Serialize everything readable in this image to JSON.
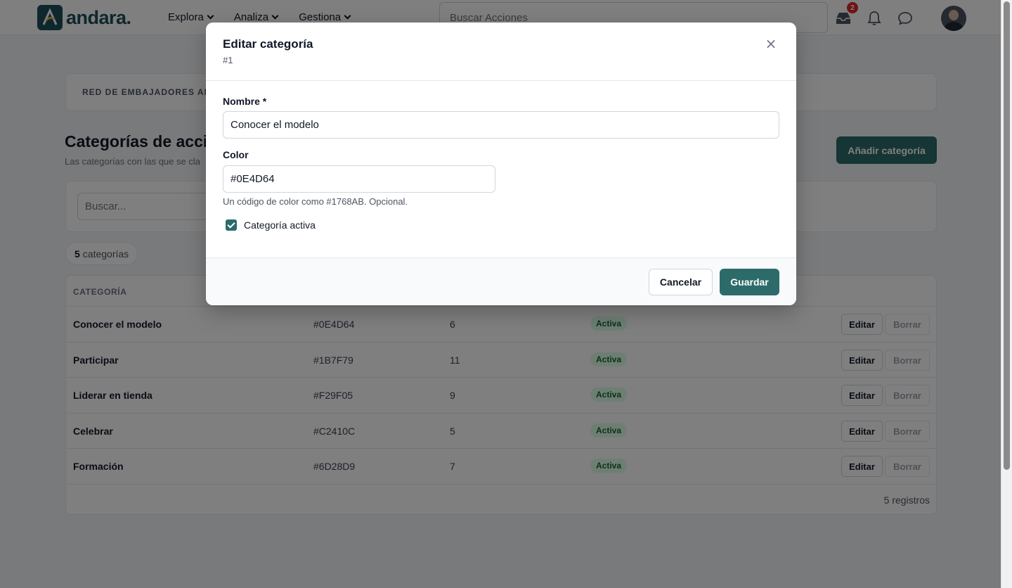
{
  "header": {
    "brand": "andara.",
    "nav": [
      {
        "label": "Explora"
      },
      {
        "label": "Analiza"
      },
      {
        "label": "Gestiona"
      }
    ],
    "search_placeholder": "Buscar Acciones",
    "inbox_badge": "2",
    "icons": [
      "inbox-icon",
      "bell-icon",
      "chat-icon"
    ]
  },
  "breadcrumb": "RED DE EMBAJADORES AND",
  "page": {
    "title": "Categorías de acci",
    "subtitle": "Las categorías con las que se cla",
    "add_button": "Añadir categoría",
    "filter_placeholder": "Buscar...",
    "count_number": "5",
    "count_label": "categorías"
  },
  "table": {
    "header": "CATEGORÍA",
    "rows": [
      {
        "name": "Conocer el modelo",
        "color": "#0E4D64",
        "count": "6",
        "status": "Activa",
        "edit": "Editar",
        "delete": "Borrar"
      },
      {
        "name": "Participar",
        "color": "#1B7F79",
        "count": "11",
        "status": "Activa",
        "edit": "Editar",
        "delete": "Borrar"
      },
      {
        "name": "Liderar en tienda",
        "color": "#F29F05",
        "count": "9",
        "status": "Activa",
        "edit": "Editar",
        "delete": "Borrar"
      },
      {
        "name": "Celebrar",
        "color": "#C2410C",
        "count": "5",
        "status": "Activa",
        "edit": "Editar",
        "delete": "Borrar"
      },
      {
        "name": "Formación",
        "color": "#6D28D9",
        "count": "7",
        "status": "Activa",
        "edit": "Editar",
        "delete": "Borrar"
      }
    ],
    "footer": "5 registros"
  },
  "modal": {
    "title": "Editar categoría",
    "subtitle": "#1",
    "close_icon": "close-icon",
    "name_label": "Nombre *",
    "name_value": "Conocer el modelo",
    "color_label": "Color",
    "color_value": "#0E4D64",
    "color_help": "Un código de color como #1768AB. Opcional.",
    "active_label": "Categoría activa",
    "active_checked": true,
    "cancel_label": "Cancelar",
    "save_label": "Guardar"
  },
  "colors": {
    "accent": "#2d6b6b",
    "brand": "#1d4f58",
    "status_bg": "#dcfce7",
    "status_text": "#166534",
    "badge": "#dc2626"
  }
}
